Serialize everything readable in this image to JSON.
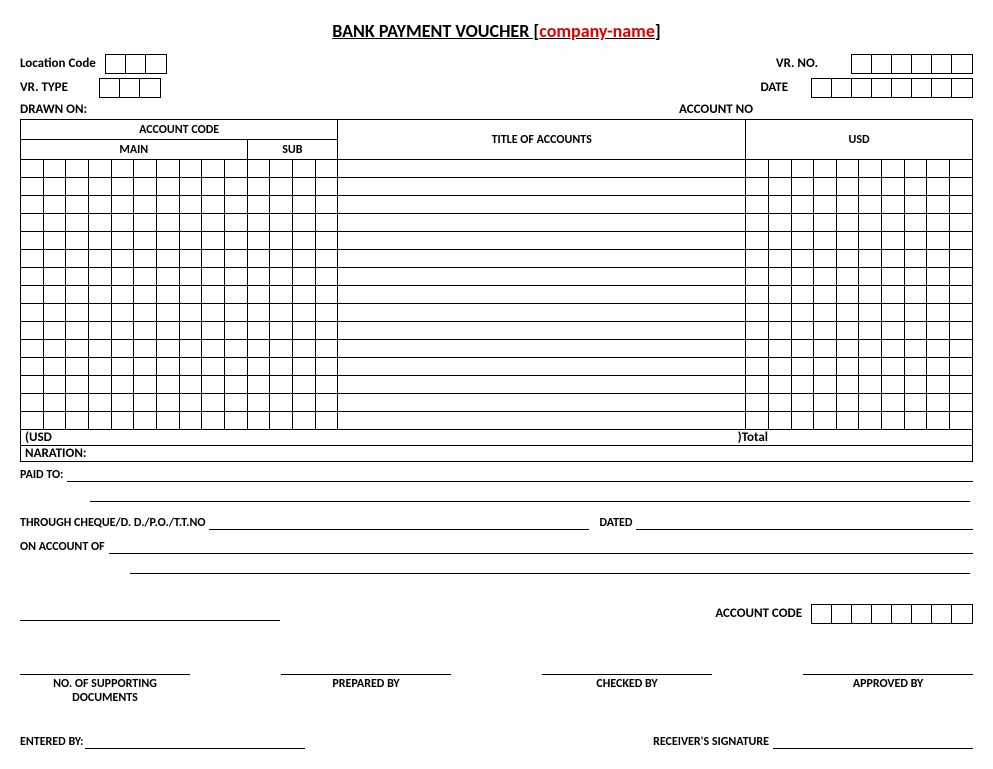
{
  "title": {
    "main": "BANK PAYMENT VOUCHER",
    "bracket_open": "  [",
    "company": "company-name",
    "bracket_close": "]"
  },
  "labels": {
    "location_code": "Location Code",
    "vr_no": "VR. NO.",
    "vr_type": "VR. TYPE",
    "date": "DATE",
    "drawn_on": "DRAWN ON:",
    "account_no": "ACCOUNT NO",
    "account_code": "ACCOUNT CODE",
    "main": "MAIN",
    "sub": "SUB",
    "title_accounts": "TITLE OF ACCOUNTS",
    "usd": "USD",
    "usd_paren": "(USD",
    "total": ")Total",
    "naration": "NARATION:",
    "paid_to": "PAID TO:",
    "through": "THROUGH  CHEQUE/D. D./P.O./T.T.NO",
    "dated": "DATED",
    "on_account_of": "ON  ACCOUNT  OF",
    "account_code2": "ACCOUNT CODE",
    "supporting": "NO. OF SUPPORTING DOCUMENTS",
    "prepared_by": "PREPARED BY",
    "checked_by": "CHECKED BY",
    "approved_by": "APPROVED BY",
    "entered_by": "ENTERED BY:",
    "receiver_sig": "RECEIVER'S SIGNATURE"
  }
}
